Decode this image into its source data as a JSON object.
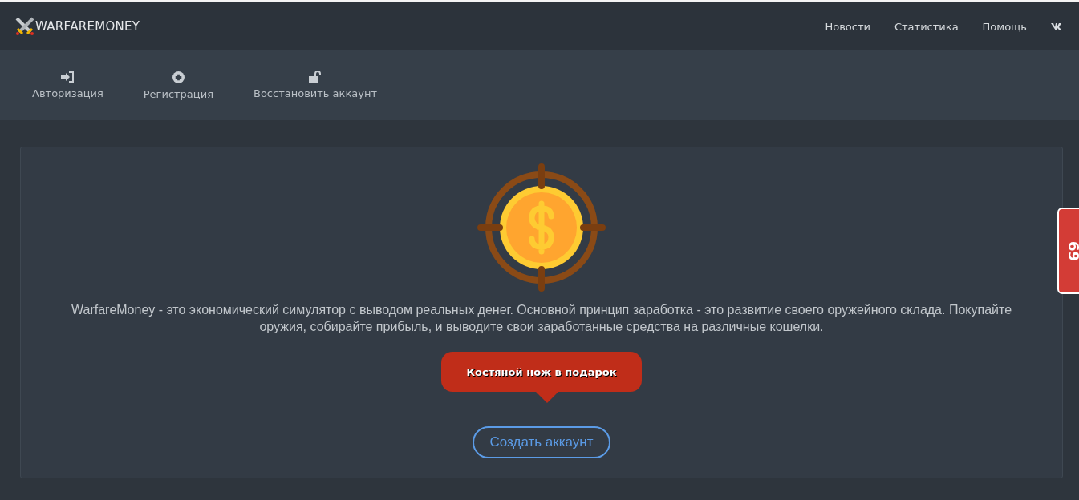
{
  "brand": {
    "name": "WARFAREMONEY"
  },
  "top_nav": [
    {
      "label": "Новости",
      "kind": "text"
    },
    {
      "label": "Статистика",
      "kind": "text"
    },
    {
      "label": "Помощь",
      "kind": "text"
    },
    {
      "kind": "vk"
    }
  ],
  "sub_nav": [
    {
      "label": "Авторизация",
      "kind": "login"
    },
    {
      "label": "Регистрация",
      "kind": "plus"
    },
    {
      "label": "Восстановить аккаунт",
      "kind": "unlock"
    }
  ],
  "hero": {
    "description": "WarfareMoney - это экономический симулятор с выводом реальных денег. Основной принцип заработка - это развитие своего оружейного склада. Покупайте оружия, собирайте прибыль, и выводите свои заработанные средства на различные кошелки.",
    "promo": "Костяной нож в подарок",
    "button": "Создать аккаунт"
  },
  "side_tab": {
    "label": "69"
  }
}
